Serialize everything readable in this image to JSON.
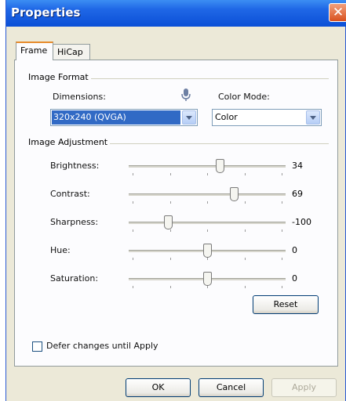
{
  "window": {
    "title": "Properties",
    "close_glyph": "✕"
  },
  "tabs": [
    {
      "label": "Frame",
      "active": true
    },
    {
      "label": "HiCap",
      "active": false
    }
  ],
  "image_format": {
    "group_label": "Image Format",
    "dimensions_label": "Dimensions:",
    "dimensions_value": "320x240 (QVGA)",
    "color_mode_label": "Color Mode:",
    "color_mode_value": "Color"
  },
  "image_adjustment": {
    "group_label": "Image Adjustment",
    "sliders": [
      {
        "label": "Brightness:",
        "value": "34",
        "level": 0.58
      },
      {
        "label": "Contrast:",
        "value": "69",
        "level": 0.67
      },
      {
        "label": "Sharpness:",
        "value": "-100",
        "level": 0.25
      },
      {
        "label": "Hue:",
        "value": "0",
        "level": 0.5
      },
      {
        "label": "Saturation:",
        "value": "0",
        "level": 0.5
      }
    ],
    "reset_label": "Reset"
  },
  "defer_label": "Defer changes until Apply",
  "buttons": {
    "ok": "OK",
    "cancel": "Cancel",
    "apply": "Apply"
  }
}
